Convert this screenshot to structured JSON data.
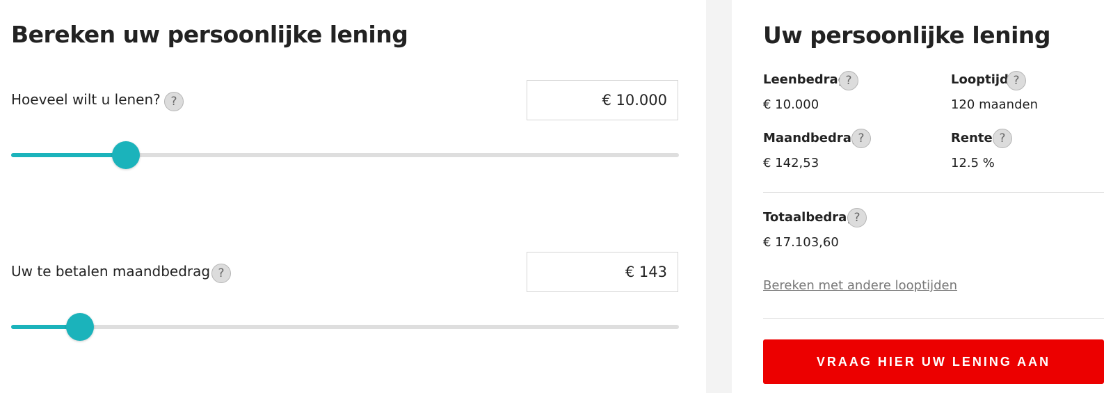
{
  "calculator": {
    "title": "Bereken uw persoonlijke lening",
    "help_symbol": "?",
    "loan_amount": {
      "label": "Hoeveel wilt u lenen?",
      "value": "€ 10.000",
      "slider_fraction": 0.172
    },
    "monthly_payment": {
      "label": "Uw te betalen maandbedrag",
      "value": "€ 143",
      "slider_fraction": 0.103
    }
  },
  "summary": {
    "title": "Uw persoonlijke lening",
    "loan_amount": {
      "label": "Leenbedrag",
      "value": "€ 10.000"
    },
    "term": {
      "label": "Looptijd",
      "value": "120 maanden"
    },
    "monthly_amount": {
      "label": "Maandbedrag",
      "value": "€ 142,53"
    },
    "interest": {
      "label": "Rente",
      "value": "12.5 %"
    },
    "total": {
      "label": "Totaalbedrag",
      "value": "€ 17.103,60"
    },
    "other_terms_link": "Bereken met andere looptijden",
    "cta_label": "VRAAG HIER UW LENING AAN"
  },
  "colors": {
    "accent_teal": "#1bb3bb",
    "cta_red": "#ec0000",
    "gutter_gray": "#f3f3f3"
  }
}
